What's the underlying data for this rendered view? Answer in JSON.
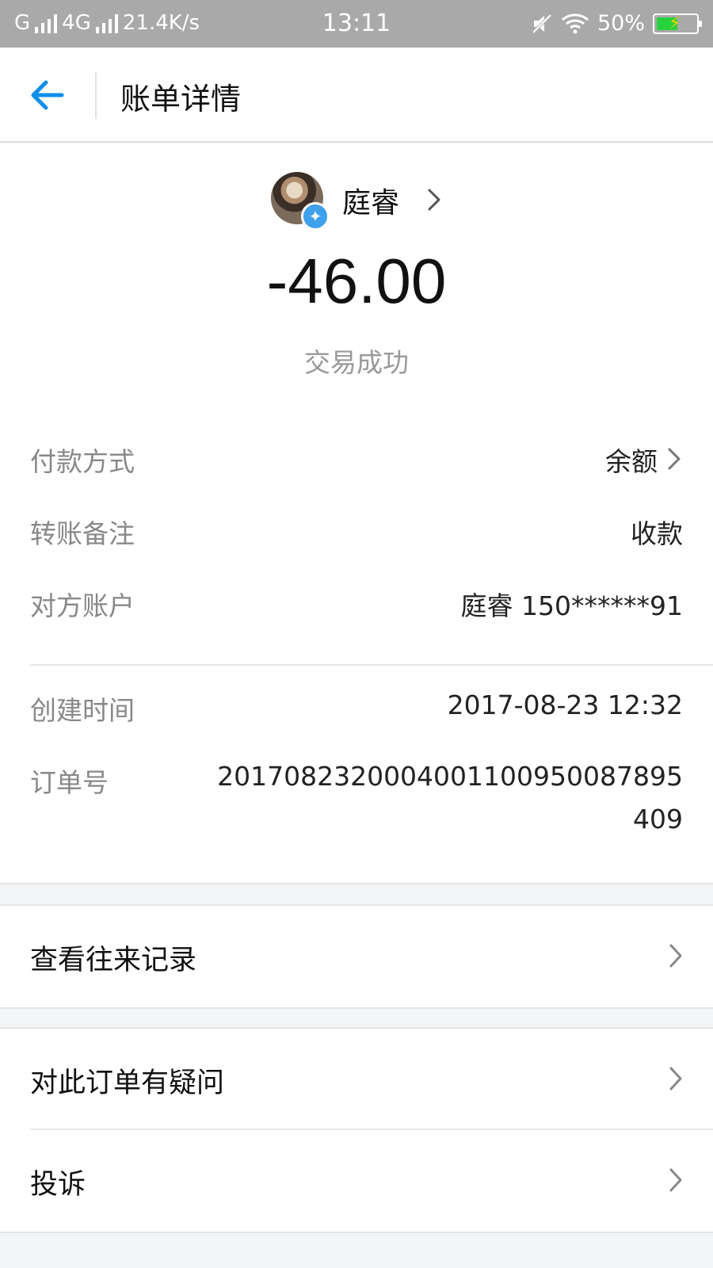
{
  "status_bar": {
    "carrier1": "G",
    "carrier2": "4G",
    "net_speed": "21.4K/s",
    "time": "13:11",
    "battery_percent": "50%"
  },
  "nav": {
    "title": "账单详情",
    "back_icon": "back-arrow-icon"
  },
  "payee": {
    "name": "庭睿",
    "badge_icon": "sparkle-icon"
  },
  "amount": "-46.00",
  "status": "交易成功",
  "details": {
    "payment_method_label": "付款方式",
    "payment_method_value": "余额",
    "remark_label": "转账备注",
    "remark_value": "收款",
    "account_label": "对方账户",
    "account_value": "庭睿 150******91",
    "created_label": "创建时间",
    "created_value": "2017-08-23 12:32",
    "order_label": "订单号",
    "order_value_line1": "2017082320004001100950087895",
    "order_value_line2": "409"
  },
  "menu": {
    "history": "查看往来记录",
    "question": "对此订单有疑问",
    "complaint": "投诉"
  },
  "colors": {
    "accent": "#108ee9",
    "status_bar": "#a9a9a9",
    "badge": "#3fa0ec"
  }
}
